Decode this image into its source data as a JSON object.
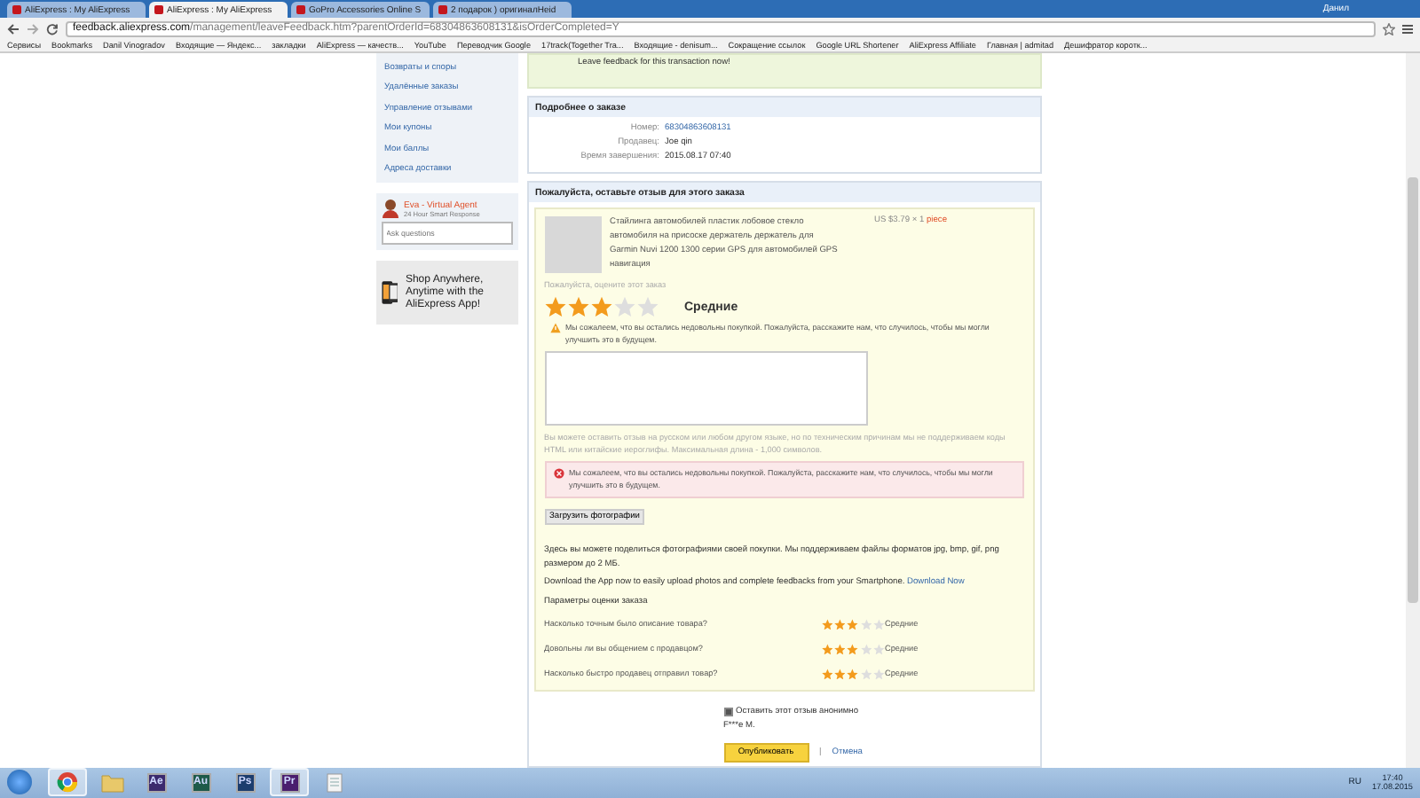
{
  "browser": {
    "tabs": [
      {
        "title": "AliExpress : My AliExpress",
        "selected": false
      },
      {
        "title": "AliExpress : My AliExpress",
        "selected": true
      },
      {
        "title": "GoPro Accessories Online S",
        "selected": false
      },
      {
        "title": "2 подарок ) оригиналHeid",
        "selected": false
      }
    ],
    "user": "Данил",
    "url_host": "feedback.aliexpress.com",
    "url_path": "/management/leaveFeedback.htm?parentOrderId=68304863608131&isOrderCompleted=Y",
    "bookmarks": [
      "Сервисы",
      "Bookmarks",
      "Danil Vinogradov",
      "Входящие — Яндекс...",
      "закладки",
      "AliExpress — качеств...",
      "YouTube",
      "Переводчик Google",
      "17track(Together Tra...",
      "Входящие - denisum...",
      "Сокращение ссылок",
      "Google URL Shortener",
      "AliExpress Affiliate",
      "Главная | admitad",
      "Дешифратор коротк..."
    ]
  },
  "sidebar": {
    "items": [
      "Возвраты и споры",
      "Удалённые заказы",
      "Управление отзывами",
      "Мои купоны",
      "Мои баллы",
      "Адреса доставки"
    ],
    "agent": {
      "name": "Eva - Virtual Agent",
      "subtitle": "24 Hour Smart Response",
      "placeholder": "Ask questions"
    },
    "promo": "Shop Anywhere, Anytime with the AliExpress App!"
  },
  "banner": "Leave feedback for this transaction now!",
  "order": {
    "title": "Подробнее о заказе",
    "fields": [
      {
        "label": "Номер:",
        "value": "68304863608131",
        "link": true
      },
      {
        "label": "Продавец:",
        "value": "Joe qin",
        "link": false
      },
      {
        "label": "Время завершения:",
        "value": "2015.08.17 07:40",
        "link": false
      }
    ]
  },
  "feedback": {
    "title": "Пожалуйста, оставьте отзыв для этого заказа",
    "product": {
      "title": "Стайлинга автомобилей пластик лобовое стекло автомобиля на присоске держатель держатель для Garmin Nuvi 1200 1300 серии GPS для автомобилей GPS навигация",
      "price": "US $3.79",
      "quantity": "× 1",
      "unit": "piece"
    },
    "prompt": "Пожалуйста, оцените этот заказ",
    "stars": 3,
    "rating_label": "Средние",
    "warning": "Мы сожалеем, что вы остались недовольны покупкой. Пожалуйста, расскажите нам, что случилось, чтобы мы могли улучшить это в будущем.",
    "hint": "Вы можете оставить отзыв на русском или любом другом языке, но по техническим причинам мы не поддерживаем коды HTML или китайские иероглифы. Максимальная длина - 1,000 символов.",
    "error": "Мы сожалеем, что вы остались недовольны покупкой. Пожалуйста, расскажите нам, что случилось, чтобы мы могли улучшить это в будущем.",
    "upload_button": "Загрузить фотографии",
    "photo_info": "Здесь вы можете поделиться фотографиями своей покупки. Мы поддерживаем файлы форматов jpg, bmp, gif, png размером до 2 МБ.",
    "app_text": "Download the App now to easily upload photos and complete feedbacks from your Smartphone.",
    "app_link": "Download Now",
    "params_title": "Параметры оценки заказа",
    "params": [
      {
        "question": "Насколько точным было описание товара?",
        "stars": 3,
        "label": "Средние"
      },
      {
        "question": "Довольны ли вы общением с продавцом?",
        "stars": 3,
        "label": "Средние"
      },
      {
        "question": "Насколько быстро продавец отправил товар?",
        "stars": 3,
        "label": "Средние"
      }
    ],
    "anonymous": {
      "checked": true,
      "label": "Оставить этот отзыв анонимно"
    },
    "name": "F***e M.",
    "publish": "Опубликовать",
    "separator": "|",
    "cancel": "Отмена"
  },
  "taskbar": {
    "apps": [
      {
        "kind": "chrome",
        "active": true
      },
      {
        "kind": "folder",
        "active": false
      },
      {
        "kind": "app",
        "label": "Ae",
        "color": "#3b2a6e",
        "active": false
      },
      {
        "kind": "app",
        "label": "Au",
        "color": "#1e5a4a",
        "active": false
      },
      {
        "kind": "app",
        "label": "Ps",
        "color": "#1c3d6e",
        "active": false
      },
      {
        "kind": "app",
        "label": "Pr",
        "color": "#4a1e6e",
        "active": true
      },
      {
        "kind": "note",
        "active": false
      }
    ],
    "lang": "RU",
    "time": "17:40",
    "date": "17.08.2015"
  }
}
